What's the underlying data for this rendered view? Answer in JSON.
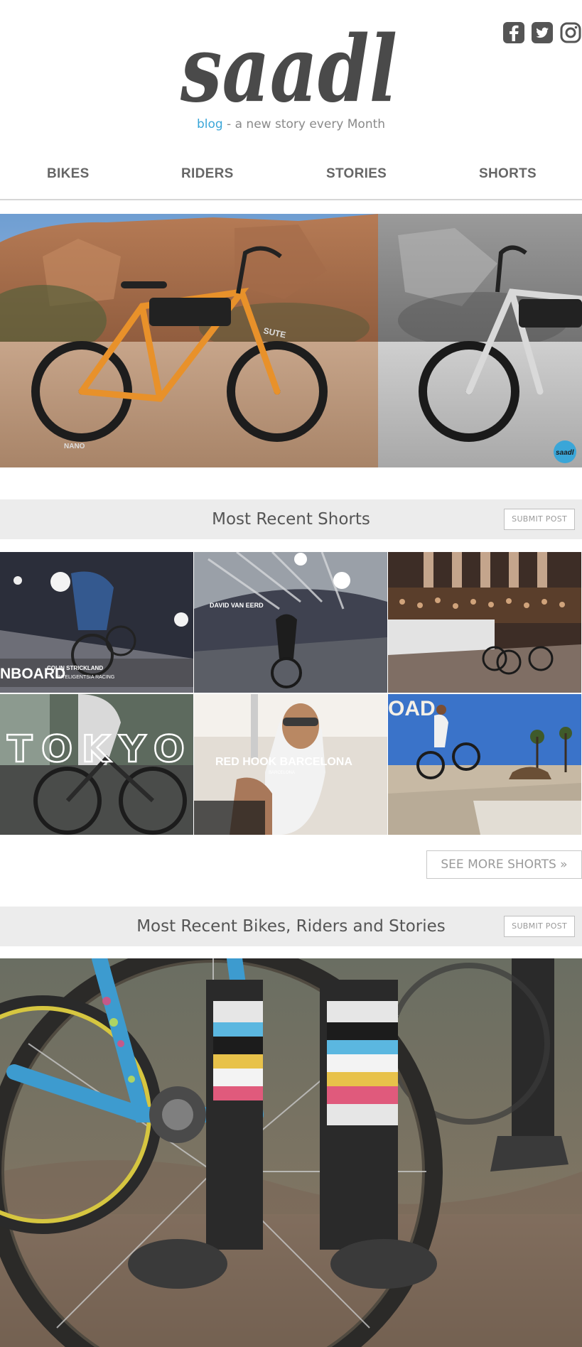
{
  "brand": {
    "logo_text": "saadl"
  },
  "tagline": {
    "blog": "blog",
    "rest": " - a new story every Month"
  },
  "social": [
    "facebook-icon",
    "twitter-icon",
    "instagram-icon"
  ],
  "nav": [
    "BIKES",
    "RIDERS",
    "STORIES",
    "SHORTS"
  ],
  "sections": {
    "shorts": {
      "title": "Most Recent Shorts",
      "submit": "SUBMIT POST"
    },
    "stories": {
      "title": "Most Recent Bikes, Riders and Stories",
      "submit": "SUBMIT POST"
    }
  },
  "shorts_tiles": [
    {
      "caption": "NBOARD",
      "sub1": "COLIN STRICKLAND",
      "sub2": "INTELIGENTSIA RACING"
    },
    {
      "caption": "DAVID VAN EERD"
    },
    {
      "caption": ""
    },
    {
      "caption": "TOKYO"
    },
    {
      "caption": "RED HOOK BARCELONA",
      "sub1": "BARCELONA"
    },
    {
      "caption": "OAD"
    }
  ],
  "hero": {
    "badge": "saadl",
    "tire_brand": "SUTE",
    "tire_label": "NANO"
  },
  "see_more": {
    "label": "SEE MORE SHORTS »"
  },
  "colors": {
    "accent": "#3aa6d8",
    "section_bg": "#ececec",
    "logo": "#4a4a4a"
  }
}
